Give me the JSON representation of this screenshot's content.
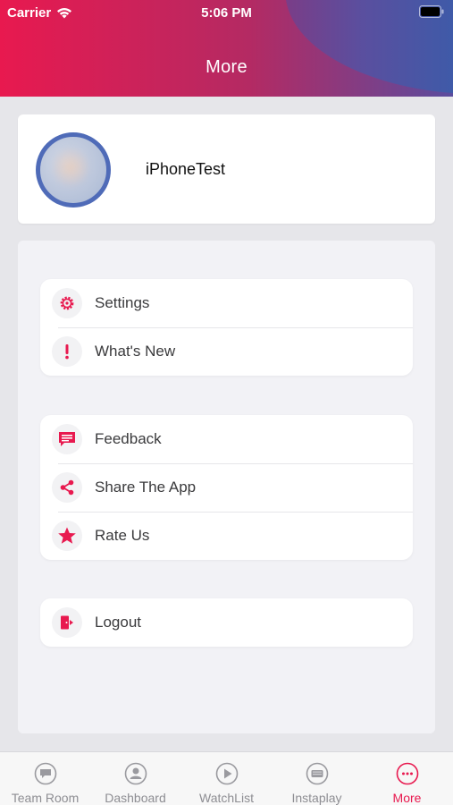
{
  "status_bar": {
    "carrier": "Carrier",
    "time": "5:06 PM"
  },
  "header": {
    "title": "More"
  },
  "profile": {
    "username": "iPhoneTest"
  },
  "menu": {
    "group1": [
      {
        "label": "Settings",
        "icon": "gear-icon"
      },
      {
        "label": "What's New",
        "icon": "exclamation-icon"
      }
    ],
    "group2": [
      {
        "label": "Feedback",
        "icon": "chat-icon"
      },
      {
        "label": "Share The App",
        "icon": "share-icon"
      },
      {
        "label": "Rate Us",
        "icon": "star-icon"
      }
    ],
    "group3": [
      {
        "label": "Logout",
        "icon": "logout-icon"
      }
    ]
  },
  "tabbar": {
    "tabs": [
      {
        "label": "Team Room",
        "icon": "chat-bubble-icon"
      },
      {
        "label": "Dashboard",
        "icon": "user-icon"
      },
      {
        "label": "WatchList",
        "icon": "play-icon"
      },
      {
        "label": "Instaplay",
        "icon": "keyboard-icon"
      },
      {
        "label": "More",
        "icon": "more-icon"
      }
    ],
    "active": "More"
  },
  "colors": {
    "accent": "#e8194f",
    "header_left": "#e8194f",
    "header_right": "#3f5aa8",
    "avatar_ring": "#4f6bb8"
  }
}
